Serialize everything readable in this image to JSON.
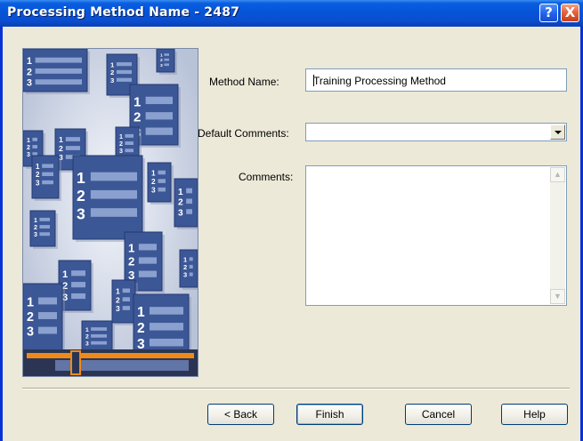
{
  "window": {
    "title": "Processing Method Name - 2487"
  },
  "titlebar_buttons": {
    "help": "?",
    "close": "X"
  },
  "form": {
    "method_name_label": "Method Name:",
    "method_name_value": "Training Processing Method",
    "default_comments_label": "Default Comments:",
    "default_comments_value": "",
    "comments_label": "Comments:",
    "comments_value": ""
  },
  "buttons": {
    "back": "< Back",
    "finish": "Finish",
    "cancel": "Cancel",
    "help": "Help"
  },
  "scrollbar": {
    "up": "▲",
    "down": "▼"
  },
  "art_numbers": [
    "1",
    "2",
    "3"
  ]
}
